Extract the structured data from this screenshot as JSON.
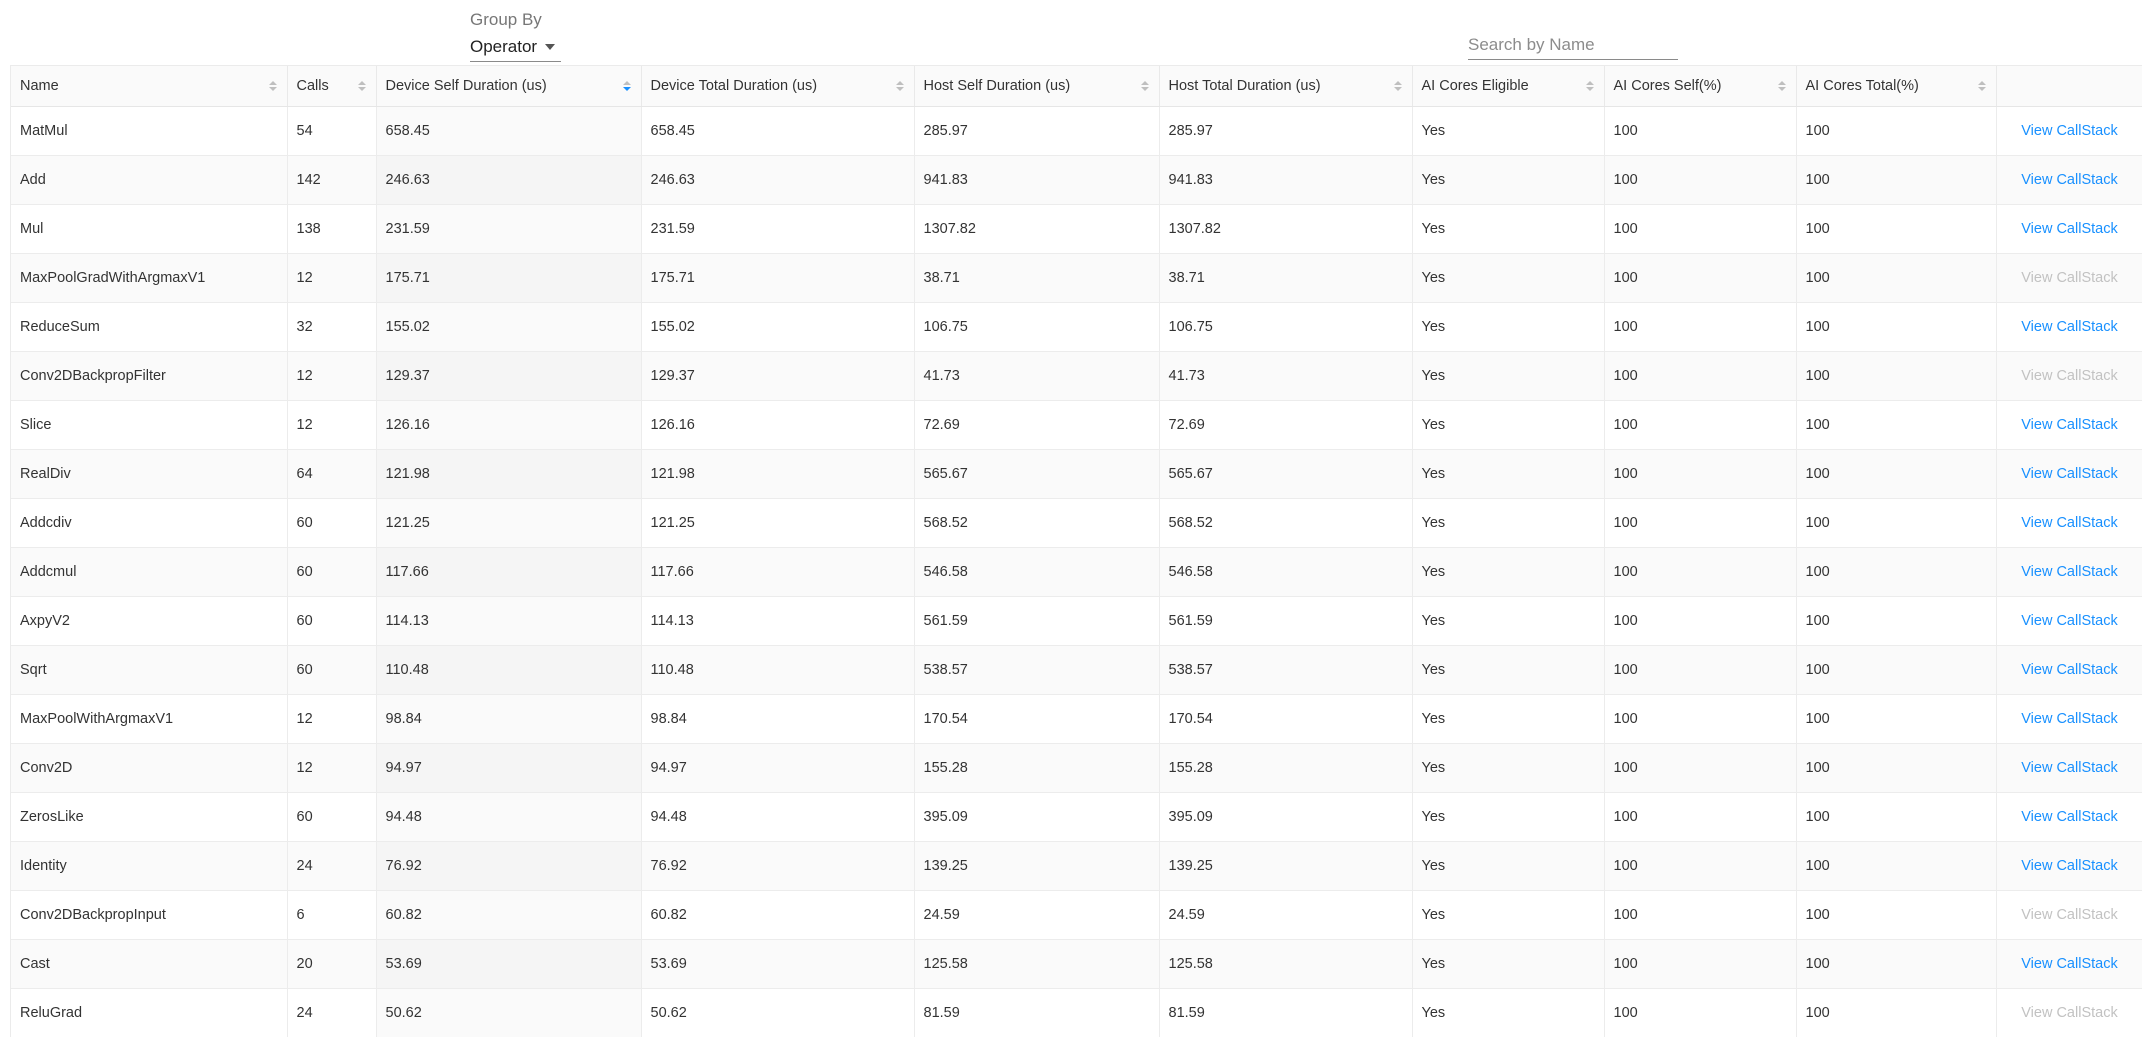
{
  "toolbar": {
    "group_by_label": "Group By",
    "group_by_value": "Operator",
    "search_placeholder": "Search by Name",
    "search_value": ""
  },
  "columns": [
    {
      "label": "Name",
      "sortable": true
    },
    {
      "label": "Calls",
      "sortable": true
    },
    {
      "label": "Device Self Duration (us)",
      "sortable": true,
      "sorted": "descending"
    },
    {
      "label": "Device Total Duration (us)",
      "sortable": true
    },
    {
      "label": "Host Self Duration (us)",
      "sortable": true
    },
    {
      "label": "Host Total Duration (us)",
      "sortable": true
    },
    {
      "label": "AI Cores Eligible",
      "sortable": true
    },
    {
      "label": "AI Cores Self(%)",
      "sortable": true
    },
    {
      "label": "AI Cores Total(%)",
      "sortable": true
    },
    {
      "label": "",
      "sortable": false
    }
  ],
  "link_label": "View CallStack",
  "colors": {
    "link": "#1890ff",
    "link_disabled": "#c2c2c2",
    "sort_active": "#1890ff"
  },
  "rows": [
    {
      "name": "MatMul",
      "calls": "54",
      "device_self": "658.45",
      "device_total": "658.45",
      "host_self": "285.97",
      "host_total": "285.97",
      "eligible": "Yes",
      "self_pct": "100",
      "total_pct": "100",
      "link_enabled": true
    },
    {
      "name": "Add",
      "calls": "142",
      "device_self": "246.63",
      "device_total": "246.63",
      "host_self": "941.83",
      "host_total": "941.83",
      "eligible": "Yes",
      "self_pct": "100",
      "total_pct": "100",
      "link_enabled": true
    },
    {
      "name": "Mul",
      "calls": "138",
      "device_self": "231.59",
      "device_total": "231.59",
      "host_self": "1307.82",
      "host_total": "1307.82",
      "eligible": "Yes",
      "self_pct": "100",
      "total_pct": "100",
      "link_enabled": true
    },
    {
      "name": "MaxPoolGradWithArgmaxV1",
      "calls": "12",
      "device_self": "175.71",
      "device_total": "175.71",
      "host_self": "38.71",
      "host_total": "38.71",
      "eligible": "Yes",
      "self_pct": "100",
      "total_pct": "100",
      "link_enabled": false
    },
    {
      "name": "ReduceSum",
      "calls": "32",
      "device_self": "155.02",
      "device_total": "155.02",
      "host_self": "106.75",
      "host_total": "106.75",
      "eligible": "Yes",
      "self_pct": "100",
      "total_pct": "100",
      "link_enabled": true
    },
    {
      "name": "Conv2DBackpropFilter",
      "calls": "12",
      "device_self": "129.37",
      "device_total": "129.37",
      "host_self": "41.73",
      "host_total": "41.73",
      "eligible": "Yes",
      "self_pct": "100",
      "total_pct": "100",
      "link_enabled": false
    },
    {
      "name": "Slice",
      "calls": "12",
      "device_self": "126.16",
      "device_total": "126.16",
      "host_self": "72.69",
      "host_total": "72.69",
      "eligible": "Yes",
      "self_pct": "100",
      "total_pct": "100",
      "link_enabled": true
    },
    {
      "name": "RealDiv",
      "calls": "64",
      "device_self": "121.98",
      "device_total": "121.98",
      "host_self": "565.67",
      "host_total": "565.67",
      "eligible": "Yes",
      "self_pct": "100",
      "total_pct": "100",
      "link_enabled": true
    },
    {
      "name": "Addcdiv",
      "calls": "60",
      "device_self": "121.25",
      "device_total": "121.25",
      "host_self": "568.52",
      "host_total": "568.52",
      "eligible": "Yes",
      "self_pct": "100",
      "total_pct": "100",
      "link_enabled": true
    },
    {
      "name": "Addcmul",
      "calls": "60",
      "device_self": "117.66",
      "device_total": "117.66",
      "host_self": "546.58",
      "host_total": "546.58",
      "eligible": "Yes",
      "self_pct": "100",
      "total_pct": "100",
      "link_enabled": true
    },
    {
      "name": "AxpyV2",
      "calls": "60",
      "device_self": "114.13",
      "device_total": "114.13",
      "host_self": "561.59",
      "host_total": "561.59",
      "eligible": "Yes",
      "self_pct": "100",
      "total_pct": "100",
      "link_enabled": true
    },
    {
      "name": "Sqrt",
      "calls": "60",
      "device_self": "110.48",
      "device_total": "110.48",
      "host_self": "538.57",
      "host_total": "538.57",
      "eligible": "Yes",
      "self_pct": "100",
      "total_pct": "100",
      "link_enabled": true
    },
    {
      "name": "MaxPoolWithArgmaxV1",
      "calls": "12",
      "device_self": "98.84",
      "device_total": "98.84",
      "host_self": "170.54",
      "host_total": "170.54",
      "eligible": "Yes",
      "self_pct": "100",
      "total_pct": "100",
      "link_enabled": true
    },
    {
      "name": "Conv2D",
      "calls": "12",
      "device_self": "94.97",
      "device_total": "94.97",
      "host_self": "155.28",
      "host_total": "155.28",
      "eligible": "Yes",
      "self_pct": "100",
      "total_pct": "100",
      "link_enabled": true
    },
    {
      "name": "ZerosLike",
      "calls": "60",
      "device_self": "94.48",
      "device_total": "94.48",
      "host_self": "395.09",
      "host_total": "395.09",
      "eligible": "Yes",
      "self_pct": "100",
      "total_pct": "100",
      "link_enabled": true
    },
    {
      "name": "Identity",
      "calls": "24",
      "device_self": "76.92",
      "device_total": "76.92",
      "host_self": "139.25",
      "host_total": "139.25",
      "eligible": "Yes",
      "self_pct": "100",
      "total_pct": "100",
      "link_enabled": true
    },
    {
      "name": "Conv2DBackpropInput",
      "calls": "6",
      "device_self": "60.82",
      "device_total": "60.82",
      "host_self": "24.59",
      "host_total": "24.59",
      "eligible": "Yes",
      "self_pct": "100",
      "total_pct": "100",
      "link_enabled": false
    },
    {
      "name": "Cast",
      "calls": "20",
      "device_self": "53.69",
      "device_total": "53.69",
      "host_self": "125.58",
      "host_total": "125.58",
      "eligible": "Yes",
      "self_pct": "100",
      "total_pct": "100",
      "link_enabled": true
    },
    {
      "name": "ReluGrad",
      "calls": "24",
      "device_self": "50.62",
      "device_total": "50.62",
      "host_self": "81.59",
      "host_total": "81.59",
      "eligible": "Yes",
      "self_pct": "100",
      "total_pct": "100",
      "link_enabled": false
    }
  ]
}
